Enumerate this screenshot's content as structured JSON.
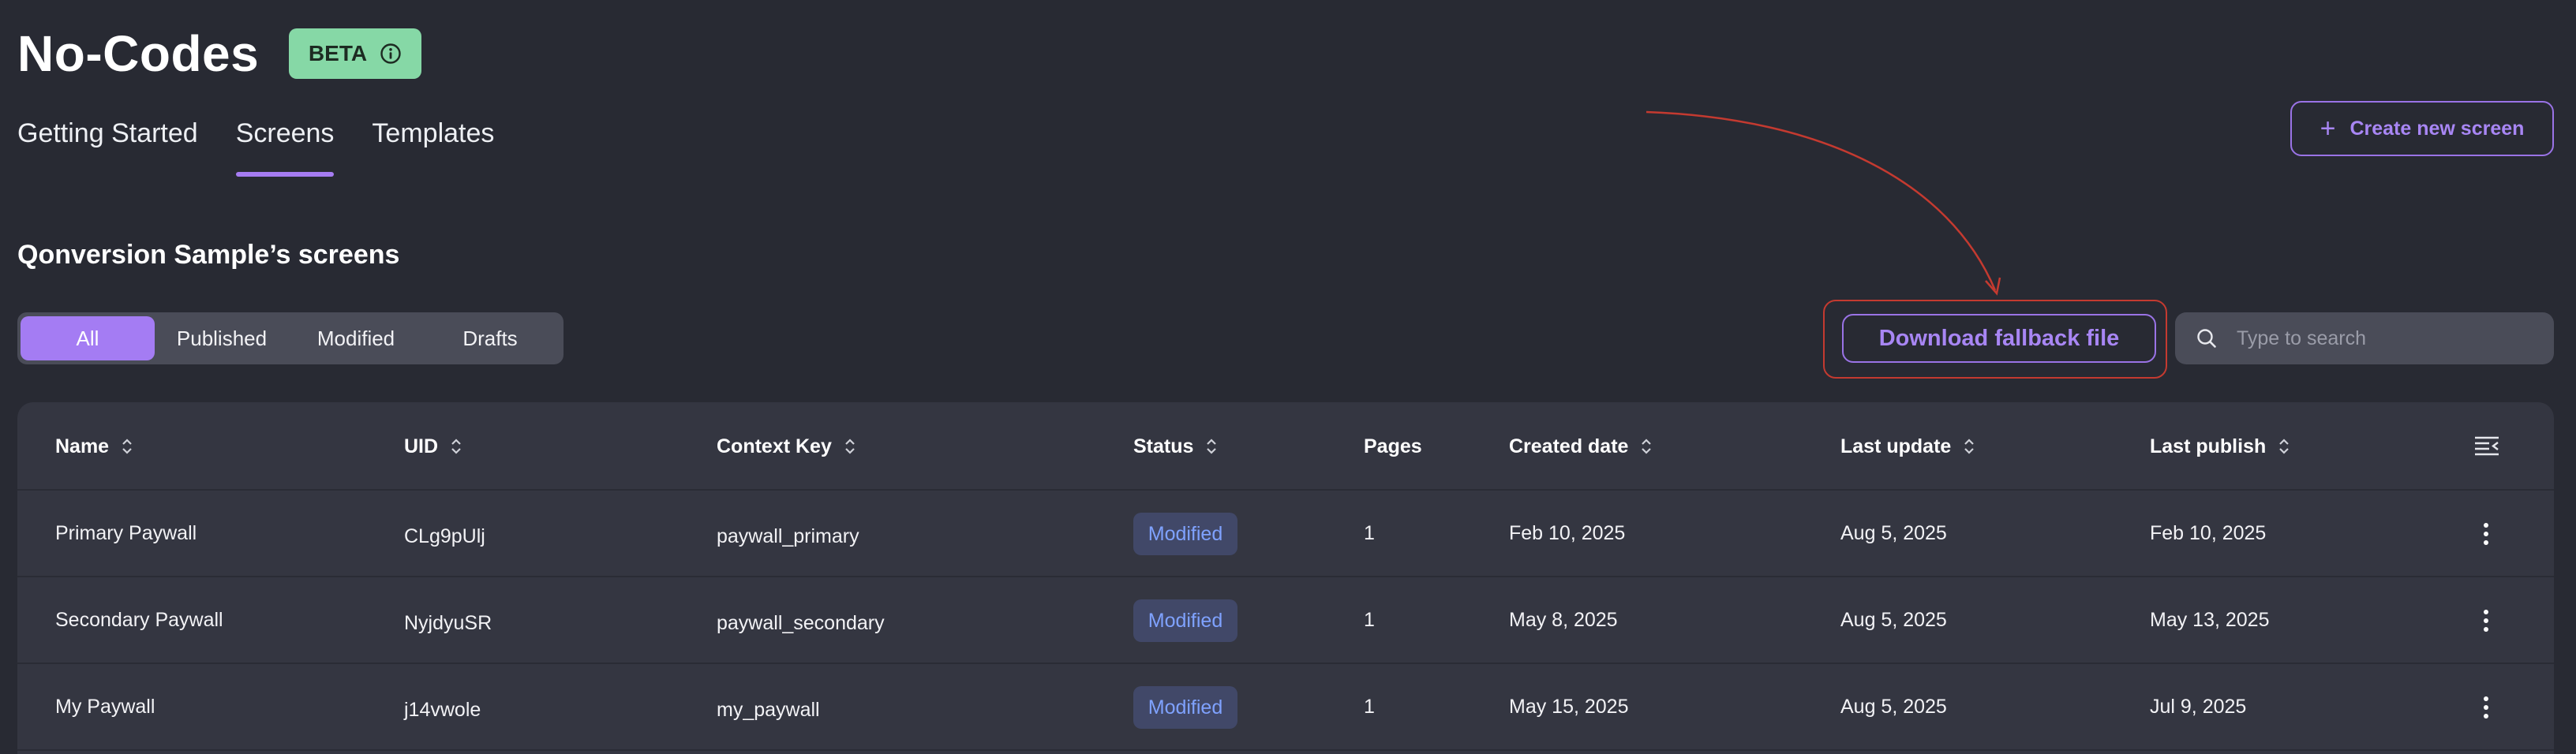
{
  "header": {
    "title": "No-Codes",
    "badge": "BETA"
  },
  "tabs": [
    {
      "label": "Getting Started",
      "active": false
    },
    {
      "label": "Screens",
      "active": true
    },
    {
      "label": "Templates",
      "active": false
    }
  ],
  "create_button": {
    "label": "Create new screen",
    "icon": "plus-icon"
  },
  "section_title": "Qonversion Sample’s screens",
  "filters": [
    {
      "label": "All",
      "active": true
    },
    {
      "label": "Published",
      "active": false
    },
    {
      "label": "Modified",
      "active": false
    },
    {
      "label": "Drafts",
      "active": false
    }
  ],
  "download_button": {
    "label": "Download fallback file"
  },
  "search": {
    "placeholder": "Type to search"
  },
  "table": {
    "columns": [
      {
        "label": "Name",
        "sortable": true
      },
      {
        "label": "UID",
        "sortable": true
      },
      {
        "label": "Context Key",
        "sortable": true
      },
      {
        "label": "Status",
        "sortable": true
      },
      {
        "label": "Pages",
        "sortable": false
      },
      {
        "label": "Created date",
        "sortable": true
      },
      {
        "label": "Last update",
        "sortable": true
      },
      {
        "label": "Last publish",
        "sortable": true
      }
    ],
    "rows": [
      {
        "name": "Primary Paywall",
        "uid": "CLg9pUlj",
        "context_key": "paywall_primary",
        "status": "Modified",
        "pages": "1",
        "created": "Feb 10, 2025",
        "updated": "Aug 5, 2025",
        "published": "Feb 10, 2025"
      },
      {
        "name": "Secondary Paywall",
        "uid": "NyjdyuSR",
        "context_key": "paywall_secondary",
        "status": "Modified",
        "pages": "1",
        "created": "May 8, 2025",
        "updated": "Aug 5, 2025",
        "published": "May 13, 2025"
      },
      {
        "name": "My Paywall",
        "uid": "j14vwole",
        "context_key": "my_paywall",
        "status": "Modified",
        "pages": "1",
        "created": "May 15, 2025",
        "updated": "Aug 5, 2025",
        "published": "Jul 9, 2025"
      }
    ]
  },
  "colors": {
    "background": "#282a33",
    "accent": "#a47cf3",
    "beta_badge": "#86d8a6",
    "status_text": "#7fa2ff",
    "annotation": "#c43a30"
  }
}
